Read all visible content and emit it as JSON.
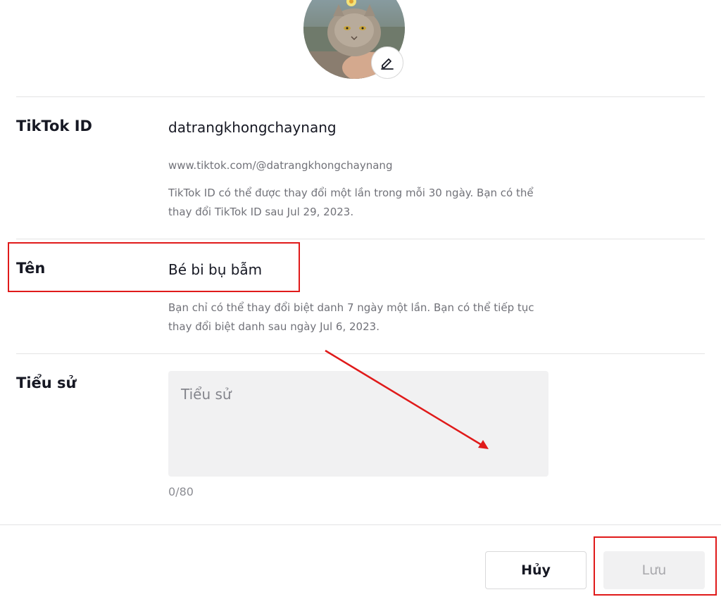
{
  "profile": {
    "avatar_alt": "Profile photo",
    "edit_icon": "pencil-edit-icon"
  },
  "tiktok_id": {
    "label": "TikTok ID",
    "value": "datrangkhongchaynang",
    "url": "www.tiktok.com/@datrangkhongchaynang",
    "hint": "TikTok ID có thể được thay đổi một lần trong mỗi 30 ngày. Bạn có thể thay đổi TikTok ID sau Jul 29, 2023."
  },
  "name": {
    "label": "Tên",
    "value": "Bé bi bụ bẫm",
    "hint": "Bạn chỉ có thể thay đổi biệt danh 7 ngày một lần. Bạn có thể tiếp tục thay đổi biệt danh sau ngày Jul 6, 2023."
  },
  "bio": {
    "label": "Tiểu sử",
    "placeholder": "Tiểu sử",
    "value": "",
    "counter": "0/80"
  },
  "actions": {
    "cancel_label": "Hủy",
    "save_label": "Lưu"
  },
  "colors": {
    "annotation_red": "#e01a1a",
    "text_primary": "#161823",
    "input_bg": "#f1f1f2"
  }
}
